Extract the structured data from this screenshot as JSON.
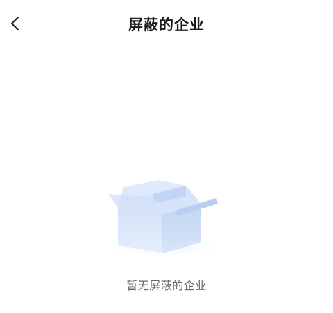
{
  "header": {
    "title": "屏蔽的企业",
    "back_icon": "chevron-left-icon"
  },
  "empty_state": {
    "illustration_icon": "empty-box-icon",
    "message": "暂无屏蔽的企业"
  },
  "colors": {
    "title_text": "#1a1a1a",
    "message_text": "#666666",
    "box_light": "#e3ecfb",
    "box_mid": "#c9daf6",
    "box_dark": "#aec6ef"
  }
}
